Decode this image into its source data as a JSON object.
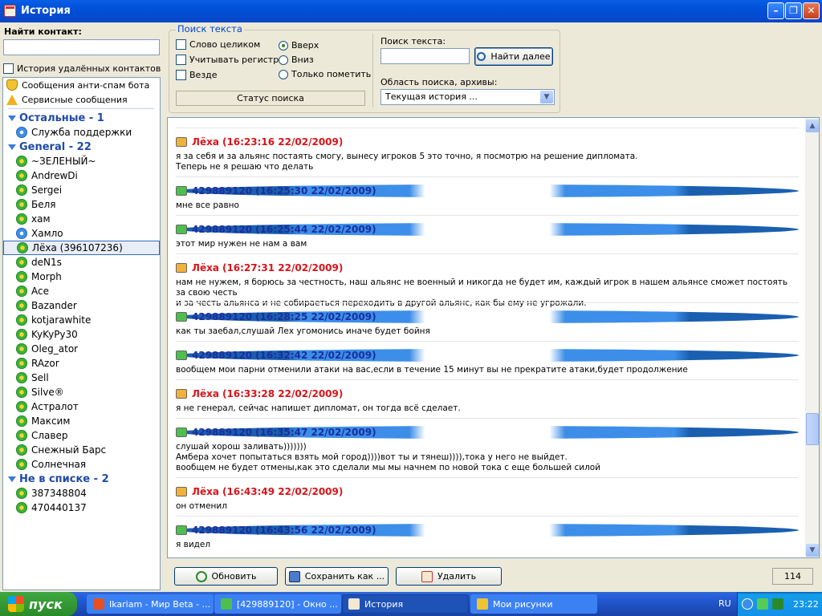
{
  "window": {
    "title": "История"
  },
  "left": {
    "find_label": "Найти контакт:",
    "find_placeholder": "",
    "deleted_history_label": "История удалённых контактов",
    "system_items": [
      {
        "label": "Сообщения анти-спам бота",
        "icon": "shield-icon"
      },
      {
        "label": "Сервисные сообщения",
        "icon": "warning-icon"
      }
    ],
    "groups": [
      {
        "label": "Остальные - 1",
        "contacts": [
          {
            "name": "Служба поддержки",
            "icon": "support-icon",
            "selected": false
          }
        ]
      },
      {
        "label": "General - 22",
        "contacts": [
          {
            "name": "~ЗЕЛЕНЫЙ~",
            "icon": "icq-flower-icon",
            "selected": false
          },
          {
            "name": "AndrewDi",
            "icon": "icq-flower-icon",
            "selected": false
          },
          {
            "name": "Sergei",
            "icon": "icq-flower-icon",
            "selected": false
          },
          {
            "name": "Беля",
            "icon": "icq-flower-icon",
            "selected": false
          },
          {
            "name": "хам",
            "icon": "icq-flower-icon",
            "selected": false
          },
          {
            "name": "Хамло",
            "icon": "support-icon",
            "selected": false
          },
          {
            "name": "Лёха (396107236)",
            "icon": "icq-flower-icon",
            "selected": true
          },
          {
            "name": "deN1s",
            "icon": "icq-flower-icon",
            "selected": false
          },
          {
            "name": "Morph",
            "icon": "icq-flower-icon",
            "selected": false
          },
          {
            "name": "Ace",
            "icon": "icq-flower-icon",
            "selected": false
          },
          {
            "name": "Bazander",
            "icon": "icq-flower-icon",
            "selected": false
          },
          {
            "name": "kotjarawhite",
            "icon": "icq-flower-icon",
            "selected": false
          },
          {
            "name": "KyKyPy30",
            "icon": "icq-flower-icon",
            "selected": false
          },
          {
            "name": "Oleg_ator",
            "icon": "icq-flower-icon",
            "selected": false
          },
          {
            "name": "RAzor",
            "icon": "icq-flower-icon",
            "selected": false
          },
          {
            "name": "Sell",
            "icon": "icq-flower-icon",
            "selected": false
          },
          {
            "name": "Silve®",
            "icon": "icq-flower-icon",
            "selected": false
          },
          {
            "name": "Астралот",
            "icon": "icq-flower-icon",
            "selected": false
          },
          {
            "name": "Максим",
            "icon": "icq-flower-icon",
            "selected": false
          },
          {
            "name": "Славер",
            "icon": "icq-flower-icon",
            "selected": false
          },
          {
            "name": "Снежный Барс",
            "icon": "icq-flower-icon",
            "selected": false
          },
          {
            "name": "Солнечная",
            "icon": "icq-flower-icon",
            "selected": false
          }
        ]
      },
      {
        "label": "Не в списке - 2",
        "contacts": [
          {
            "name": "387348804",
            "icon": "icq-flower-icon",
            "selected": false
          },
          {
            "name": "470440137",
            "icon": "icq-flower-icon",
            "selected": false
          }
        ]
      }
    ]
  },
  "search": {
    "title": "Поиск текста",
    "whole_word": "Слово целиком",
    "match_case": "Учитывать регистр",
    "everywhere": "Везде",
    "up": "Вверх",
    "down": "Вниз",
    "mark_only": "Только пометить",
    "status_button": "Статус поиска",
    "text_label": "Поиск текста:",
    "text_value": "",
    "find_next": "Найти далее",
    "area_label": "Область поиска, архивы:",
    "area_value": "Текущая история ..."
  },
  "messages": [
    {
      "sender": "Лёха",
      "time": "(16:23:16 22/02/2009)",
      "kind": "them",
      "text": "я за себя и за альянс постаять смогу, вынесу игроков 5 это точно, я посмотрю на решение дипломата.\nТеперь не я решаю что делать"
    },
    {
      "sender": "429889120",
      "time": "(16:25:30 22/02/2009)",
      "kind": "me",
      "text": "мне все равно"
    },
    {
      "sender": "429889120",
      "time": "(16:25:44 22/02/2009)",
      "kind": "me",
      "text": "этот мир нужен не нам а вам"
    },
    {
      "sender": "Лёха",
      "time": "(16:27:31 22/02/2009)",
      "kind": "them",
      "text": "нам не нужем, я борюсь за честность, наш альянс не военный и никогда не будет им, каждый игрок в нашем альянсе сможет постоять за свою честь\nи за честь альянса и не собираеться переходить в другой альянс, как бы ему не угрожали."
    },
    {
      "sender": "429889120",
      "time": "(16:28:25 22/02/2009)",
      "kind": "me",
      "text": "как ты заебал,слушай Лех угомонись иначе будет бойня"
    },
    {
      "sender": "429889120",
      "time": "(16:32:42 22/02/2009)",
      "kind": "me",
      "text": "вообщем мои парни отменили атаки на вас,если в течение 15 минут вы не прекратите атаки,будет продолжение"
    },
    {
      "sender": "Лёха",
      "time": "(16:33:28 22/02/2009)",
      "kind": "them",
      "text": "я не генерал, сейчас напишет дипломат, он тогда всё сделает."
    },
    {
      "sender": "429889120",
      "time": "(16:35:47 22/02/2009)",
      "kind": "me",
      "text": "слушай хорош заливать)))))))\nАмбера хочет попытаться взять мой город))))вот ты и тянеш)))),тока у него не выйдет.\nвообщем не будет отмены,как это сделали мы мы начнем по новой тока с еще большей силой"
    },
    {
      "sender": "Лёха",
      "time": "(16:43:49 22/02/2009)",
      "kind": "them",
      "text": "он отменил"
    },
    {
      "sender": "429889120",
      "time": "(16:43:56 22/02/2009)",
      "kind": "me",
      "text": "я видел"
    }
  ],
  "buttons": {
    "refresh": "Обновить",
    "save_as": "Сохранить как ...",
    "delete": "Удалить"
  },
  "message_count": "114",
  "taskbar": {
    "start": "пуск",
    "tasks": [
      {
        "label": "Ikariam - Мир Beta - ...",
        "active": false
      },
      {
        "label": "[429889120] - Окно ...",
        "active": false
      },
      {
        "label": "История",
        "active": true
      },
      {
        "label": "Мои рисунки",
        "active": false
      }
    ],
    "lang": "RU",
    "clock": "23:22"
  },
  "colors": {
    "them": "#d8141a",
    "me": "#1a2e9c",
    "accent": "#0046d5"
  }
}
